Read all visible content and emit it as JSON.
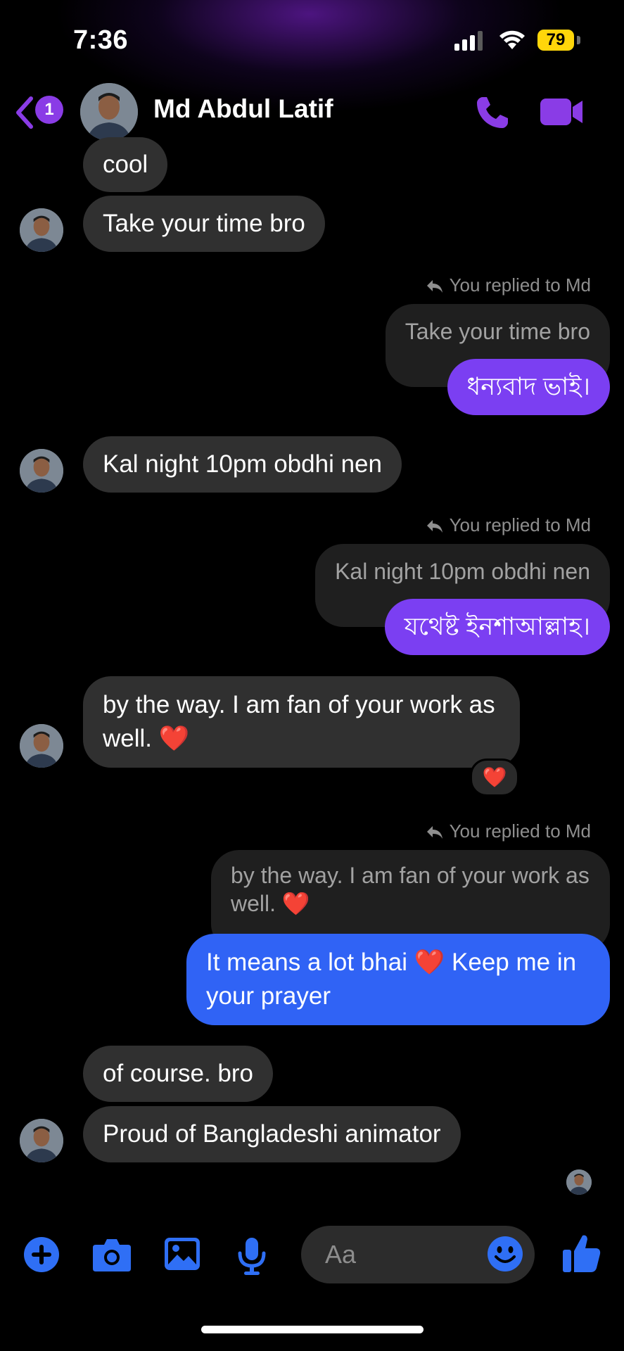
{
  "status_bar": {
    "time": "7:36",
    "battery": "79"
  },
  "header": {
    "unread_count": "1",
    "contact_name": "Md Abdul Latif"
  },
  "colors": {
    "accent_purple": "#8a3ce6",
    "bubble_purple": "#7b3ff2",
    "bubble_blue": "#3063f5",
    "incoming_bubble": "#303030"
  },
  "messages": {
    "m1": "cool",
    "m2": "Take your time bro",
    "r1_label": "You replied to Md",
    "r1_quote": "Take your time bro",
    "r1_text": "ধন্যবাদ ভাই।",
    "m3": "Kal night 10pm obdhi nen",
    "r2_label": "You replied to Md",
    "r2_quote": "Kal night 10pm obdhi nen",
    "r2_text": "যথেষ্ট ইনশাআল্লাহ।",
    "m4": "by the way. I am fan of your work as well. ❤️",
    "m4_reaction": "❤️",
    "r3_label": "You replied to Md",
    "r3_quote": "by the way. I am fan of your work as well. ❤️",
    "r3_text": "It means a lot bhai ❤️ Keep me in your prayer",
    "m5": "of course. bro",
    "m6": "Proud of Bangladeshi animator"
  },
  "composer": {
    "placeholder": "Aa",
    "icons": [
      "plus-icon",
      "camera-icon",
      "gallery-icon",
      "microphone-icon",
      "emoji-icon",
      "thumbs-up-icon"
    ]
  }
}
